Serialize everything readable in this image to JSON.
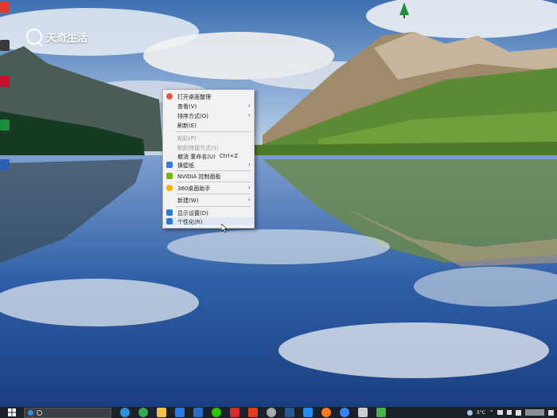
{
  "watermark": {
    "brand_text": "天奇生活"
  },
  "desktop_icons": [
    {
      "label": "",
      "color": "#e03a2c"
    },
    {
      "label": "",
      "color": "#3a3a3a"
    },
    {
      "label": "",
      "color": "#c8102e"
    },
    {
      "label": "",
      "color": "#1e8e3e"
    },
    {
      "label": "",
      "color": "#2b5fb4"
    }
  ],
  "context_menu": {
    "items": [
      {
        "label": "打开桌面整理",
        "icon": "desktop-organizer-icon",
        "color": "#e2574c"
      },
      {
        "label": "查看(V)",
        "submenu": true
      },
      {
        "label": "排序方式(O)",
        "submenu": true
      },
      {
        "label": "刷新(E)"
      },
      {
        "label": "粘贴(P)",
        "disabled": true
      },
      {
        "label": "粘贴快捷方式(S)",
        "disabled": true
      },
      {
        "label": "撤消 重命名(U)",
        "shortcut": "Ctrl+Z"
      },
      {
        "label": "换壁纸",
        "submenu": true,
        "icon": "wallpaper-icon",
        "color": "#3a7bd5"
      },
      {
        "label": "NVIDIA 控制面板",
        "icon": "nvidia-icon",
        "color": "#76b900"
      },
      {
        "label": "360桌面助手",
        "submenu": true,
        "icon": "desktop-assistant-icon",
        "color": "#f5b400"
      },
      {
        "label": "新建(W)",
        "submenu": true
      },
      {
        "label": "显示设置(D)",
        "icon": "display-settings-icon",
        "color": "#2b7bd3"
      },
      {
        "label": "个性化(R)",
        "icon": "personalize-icon",
        "color": "#2b7bd3"
      }
    ]
  },
  "taskbar": {
    "apps": [
      {
        "name": "browser-edge-icon",
        "color": "#2f8fe0"
      },
      {
        "name": "browser-chrome-icon",
        "color": "#34a853"
      },
      {
        "name": "file-explorer-icon",
        "color": "#f2c24a"
      },
      {
        "name": "store-icon",
        "color": "#2a7ae2"
      },
      {
        "name": "photoshop-icon",
        "color": "#2d6cc9"
      },
      {
        "name": "wechat-icon",
        "color": "#2dc100"
      },
      {
        "name": "wps-icon",
        "color": "#d42b2b"
      },
      {
        "name": "app-red-icon",
        "color": "#e63a1f"
      },
      {
        "name": "settings-icon",
        "color": "#aaaaaa"
      },
      {
        "name": "word-icon",
        "color": "#2b5797"
      },
      {
        "name": "mail-icon",
        "color": "#1f8ef1"
      },
      {
        "name": "app-orange-icon",
        "color": "#ff7a1a"
      },
      {
        "name": "app-blue-icon",
        "color": "#3b82f6"
      },
      {
        "name": "app-gray-icon",
        "color": "#cccccc"
      },
      {
        "name": "app-green-icon",
        "color": "#4caf50"
      }
    ],
    "tray": {
      "temperature": "5°C"
    }
  }
}
